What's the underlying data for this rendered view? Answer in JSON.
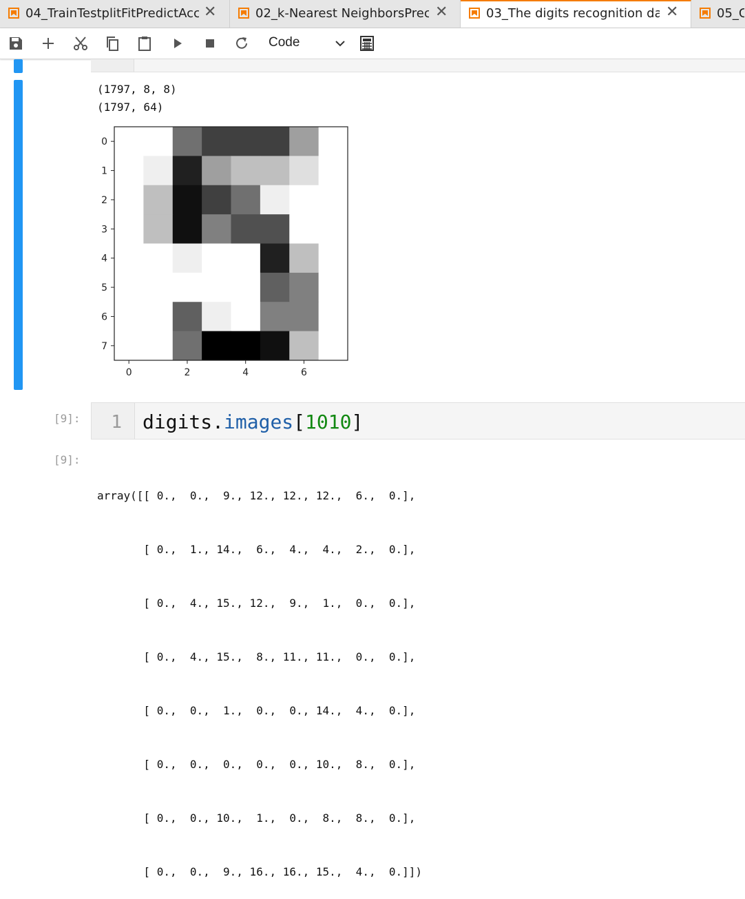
{
  "tabs": [
    {
      "label": "04_TrainTestplitFitPredictAcc",
      "active": false
    },
    {
      "label": "02_k-Nearest NeighborsPrec",
      "active": false
    },
    {
      "label": "03_The digits recognition da",
      "active": true
    },
    {
      "label": "05_C",
      "active": false
    }
  ],
  "toolbar": {
    "save_icon": "save-icon",
    "cell_type": "Code"
  },
  "cells": {
    "shapes_output": [
      "(1797, 8, 8)",
      "(1797, 64)"
    ],
    "code_cell": {
      "prompt": "[9]:",
      "line_number": "1",
      "code_obj": "digits.",
      "code_attr": "images",
      "code_open": "[",
      "code_num": "1010",
      "code_close": "]"
    },
    "output_cell": {
      "prompt": "[9]:",
      "lines": [
        "array([[ 0.,  0.,  9., 12., 12., 12.,  6.,  0.],",
        "       [ 0.,  1., 14.,  6.,  4.,  4.,  2.,  0.],",
        "       [ 0.,  4., 15., 12.,  9.,  1.,  0.,  0.],",
        "       [ 0.,  4., 15.,  8., 11., 11.,  0.,  0.],",
        "       [ 0.,  0.,  1.,  0.,  0., 14.,  4.,  0.],",
        "       [ 0.,  0.,  0.,  0.,  0., 10.,  8.,  0.],",
        "       [ 0.,  0., 10.,  1.,  0.,  8.,  8.,  0.],",
        "       [ 0.,  0.,  9., 16., 16., 15.,  4.,  0.]])"
      ]
    }
  },
  "chart_data": {
    "type": "heatmap",
    "colormap": "gray_r",
    "values": [
      [
        0,
        0,
        9,
        12,
        12,
        12,
        6,
        0
      ],
      [
        0,
        1,
        14,
        6,
        4,
        4,
        2,
        0
      ],
      [
        0,
        4,
        15,
        12,
        9,
        1,
        0,
        0
      ],
      [
        0,
        4,
        15,
        8,
        11,
        11,
        0,
        0
      ],
      [
        0,
        0,
        1,
        0,
        0,
        14,
        4,
        0
      ],
      [
        0,
        0,
        0,
        0,
        0,
        10,
        8,
        0
      ],
      [
        0,
        0,
        10,
        1,
        0,
        8,
        8,
        0
      ],
      [
        0,
        0,
        9,
        16,
        16,
        15,
        4,
        0
      ]
    ],
    "vmax": 16,
    "x_ticks": [
      "0",
      "2",
      "4",
      "6"
    ],
    "y_ticks": [
      "0",
      "1",
      "2",
      "3",
      "4",
      "5",
      "6",
      "7"
    ]
  }
}
